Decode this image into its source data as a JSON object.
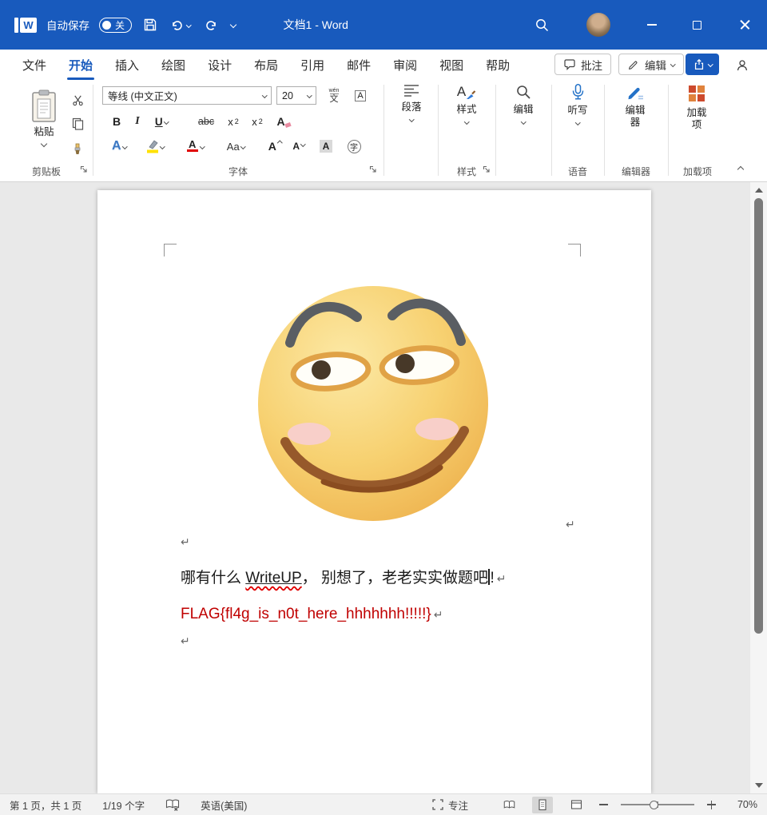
{
  "colors": {
    "titlebar_blue": "#185abd",
    "accent_blue": "#185abd",
    "flag_red": "#c00000"
  },
  "titlebar": {
    "logo_letter": "W",
    "autosave_label": "自动保存",
    "autosave_state": "关",
    "doc_title": "文档1 - Word"
  },
  "tabs": [
    {
      "label": "文件"
    },
    {
      "label": "开始"
    },
    {
      "label": "插入"
    },
    {
      "label": "绘图"
    },
    {
      "label": "设计"
    },
    {
      "label": "布局"
    },
    {
      "label": "引用"
    },
    {
      "label": "邮件"
    },
    {
      "label": "审阅"
    },
    {
      "label": "视图"
    },
    {
      "label": "帮助"
    }
  ],
  "tab_actions": {
    "comments_label": "批注",
    "editing_label": "编辑"
  },
  "ribbon": {
    "clipboard": {
      "paste_label": "粘贴",
      "group_label": "剪贴板"
    },
    "font": {
      "group_label": "字体",
      "font_name": "等线 (中文正文)",
      "font_size": "20",
      "phonetic_top": "wén",
      "phonetic_bottom": "文",
      "char_border_letter": "A",
      "bold": "B",
      "italic": "I",
      "underline": "U",
      "strike": "abc",
      "sub_base": "x",
      "sub_mark": "2",
      "sup_base": "x",
      "sup_mark": "2",
      "clear_letter": "A",
      "effects_letter": "A",
      "case_label": "Aa",
      "color_letter": "A",
      "grow_letter": "A",
      "shrink_letter": "A",
      "shading_letter": "A",
      "enclose_char": "字"
    },
    "paragraph": {
      "button_label": "段落"
    },
    "styles": {
      "icon_letter": "A",
      "button_label": "样式",
      "group_label": "样式"
    },
    "editing": {
      "button_label": "编辑"
    },
    "voice": {
      "dictate_label": "听写",
      "group_label": "语音"
    },
    "editor": {
      "button_label": "编辑器",
      "group_label": "编辑器"
    },
    "addins": {
      "button_label": "加载项",
      "group_label": "加载项"
    }
  },
  "document": {
    "pilcrow": "↵",
    "line1_seg1": "哪有什么 ",
    "line1_word": "WriteUP",
    "line1_seg2": "， 别想了，老老实实做题吧",
    "line1_seg3": "!",
    "line2_flag": "FLAG{fl4g_is_n0t_here_hhhhhhh!!!!!}"
  },
  "statusbar": {
    "page_info": "第 1 页，共 1 页",
    "word_count": "1/19 个字",
    "language": "英语(美国)",
    "focus_label": "专注",
    "zoom_value": "70%"
  }
}
